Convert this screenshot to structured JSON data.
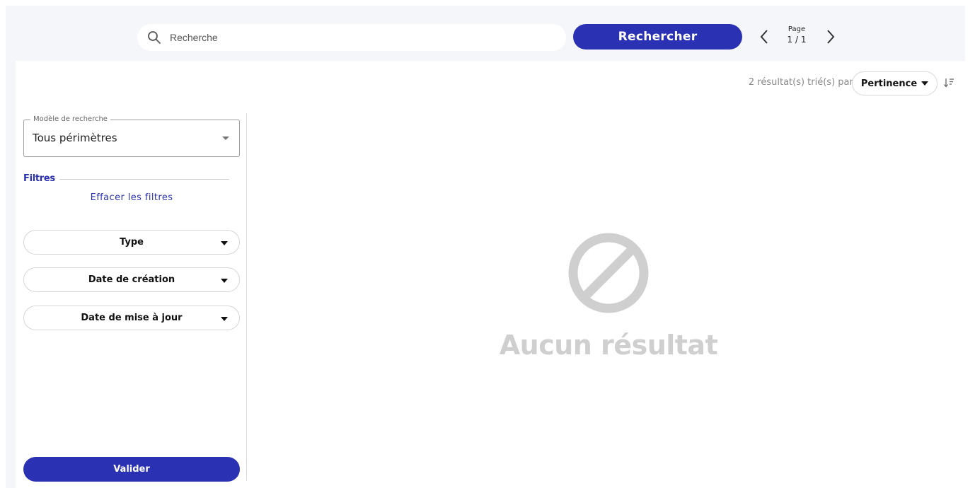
{
  "search": {
    "placeholder": "Recherche",
    "value": "",
    "button_label": "Rechercher",
    "icon": "search-icon"
  },
  "pager": {
    "label": "Page",
    "value": "1 / 1",
    "prev_icon": "chevron-left-icon",
    "next_icon": "chevron-right-icon"
  },
  "results": {
    "summary": "2 résultat(s) trié(s) par:",
    "sort_selected": "Pertinence",
    "sort_direction_icon": "sort-descending-icon"
  },
  "sidebar": {
    "model_legend": "Modèle de recherche",
    "model_value": "Tous périmètres",
    "filters_title": "Filtres",
    "clear_filters": "Effacer les filtres",
    "filters": [
      {
        "label": "Type"
      },
      {
        "label": "Date de création"
      },
      {
        "label": "Date de mise à jour"
      }
    ],
    "validate_label": "Valider"
  },
  "empty_state": {
    "icon": "no-results-icon",
    "text": "Aucun résultat"
  },
  "colors": {
    "accent": "#2b31b3",
    "background": "#f5f6fa",
    "muted": "#cfcfcf"
  }
}
